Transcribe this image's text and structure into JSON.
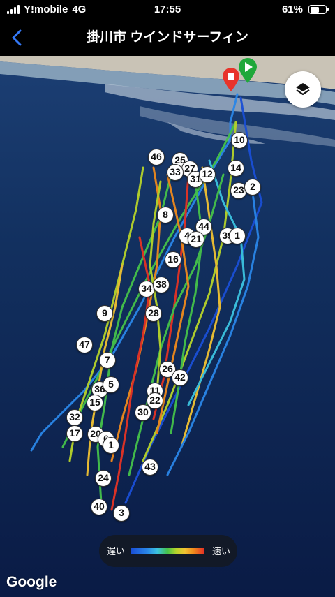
{
  "status_bar": {
    "carrier": "Y!mobile",
    "network": "4G",
    "time": "17:55",
    "battery_text": "61%",
    "battery_level": 0.61
  },
  "nav": {
    "back_icon": "chevron-left-icon",
    "title": "掛川市 ウインドサーフィン"
  },
  "map": {
    "layers_icon": "layers-icon",
    "start_icon": "play-icon",
    "end_icon": "stop-icon",
    "lap_markers": [
      "10",
      "46",
      "25",
      "27",
      "33",
      "31",
      "12",
      "14",
      "23",
      "2",
      "8",
      "44",
      "4",
      "21",
      "39",
      "1",
      "16",
      "34",
      "38",
      "9",
      "28",
      "47",
      "7",
      "26",
      "42",
      "36",
      "5",
      "11",
      "22",
      "15",
      "30",
      "32",
      "17",
      "20",
      "6",
      "1",
      "24",
      "43",
      "40",
      "3"
    ],
    "legend": {
      "slow_label": "遅い",
      "fast_label": "速い"
    },
    "attribution": "Google"
  },
  "colors": {
    "accent": "#3478f6",
    "start_marker": "#1fa83a",
    "end_marker": "#e8332a",
    "ocean_dark": "#0b1e4a",
    "beach": "#c9c3b6"
  }
}
